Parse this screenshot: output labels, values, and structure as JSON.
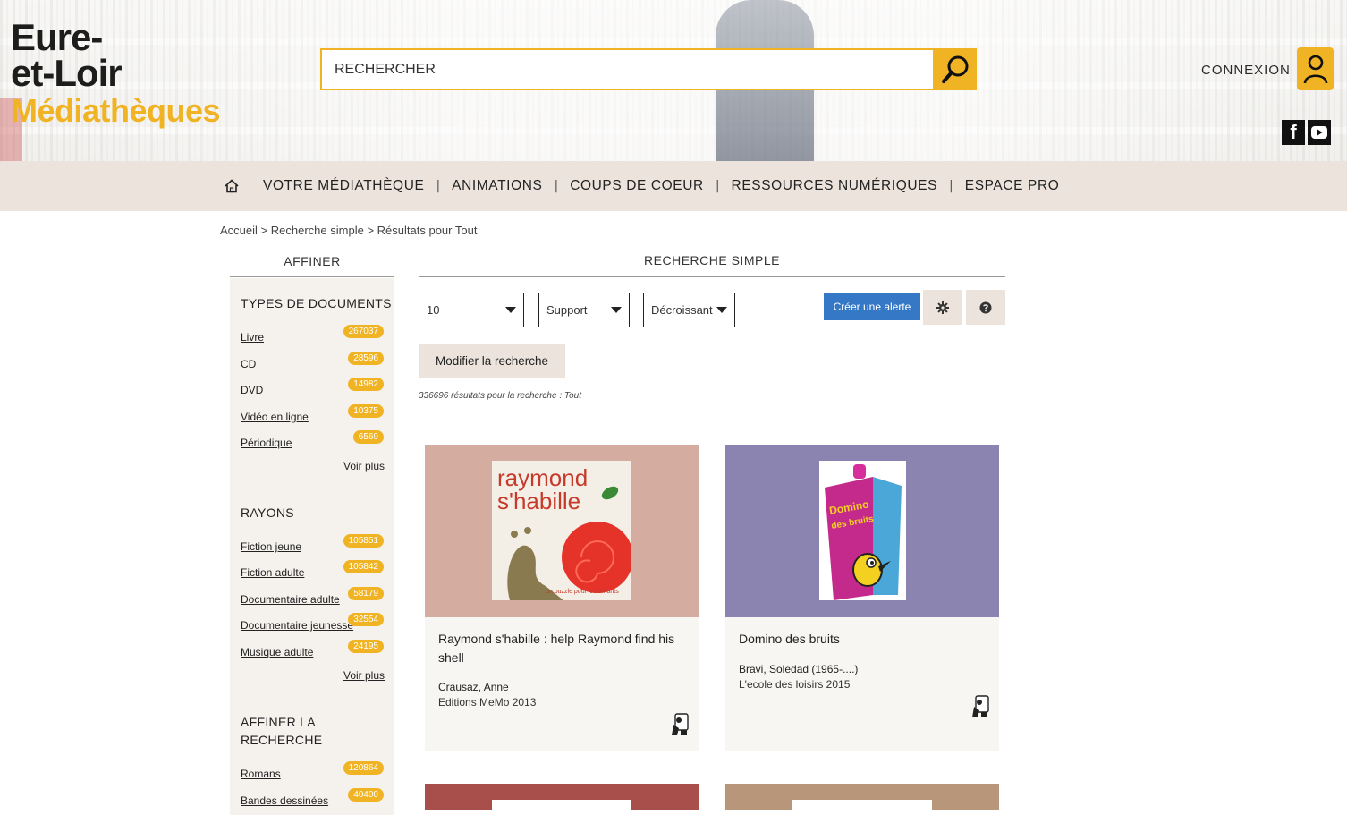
{
  "header": {
    "logo": {
      "line1": "Eure-",
      "line2": "et-Loir",
      "line3": "Médiathèques"
    },
    "search": {
      "placeholder": "RECHERCHER",
      "button_icon": "search-icon"
    },
    "connexion_label": "CONNEXION",
    "user_icon": "user-icon",
    "social": {
      "facebook": "f"
    }
  },
  "nav": {
    "home_icon": "home-icon",
    "items": [
      {
        "label": "VOTRE MÉDIATHÈQUE"
      },
      {
        "label": "ANIMATIONS"
      },
      {
        "label": "COUPS DE COEUR"
      },
      {
        "label": "RESSOURCES NUMÉRIQUES"
      },
      {
        "label": "ESPACE PRO"
      }
    ],
    "separator": "|"
  },
  "breadcrumb": {
    "home": "Accueil",
    "sep": ">",
    "search": "Recherche simple",
    "results": "Résultats pour Tout"
  },
  "sidebar": {
    "title": "AFFINER",
    "facets": [
      {
        "title": "TYPES DE DOCUMENTS",
        "items": [
          {
            "label": "Livre",
            "count": "267037"
          },
          {
            "label": "CD",
            "count": "28596"
          },
          {
            "label": "DVD",
            "count": "14982"
          },
          {
            "label": "Vidéo en ligne",
            "count": "10375"
          },
          {
            "label": "Périodique",
            "count": "6569"
          }
        ],
        "more": "Voir plus"
      },
      {
        "title": "RAYONS",
        "items": [
          {
            "label": "Fiction jeune",
            "count": "105851"
          },
          {
            "label": "Fiction adulte",
            "count": "105842"
          },
          {
            "label": "Documentaire adulte",
            "count": "58179"
          },
          {
            "label": "Documentaire jeunesse",
            "count": "32554"
          },
          {
            "label": "Musique adulte",
            "count": "24195"
          }
        ],
        "more": "Voir plus"
      },
      {
        "title_line1": "AFFINER LA",
        "title_line2": "RECHERCHE",
        "items": [
          {
            "label": "Romans",
            "count": "120864"
          },
          {
            "label": "Bandes dessinées",
            "count": "40400"
          }
        ]
      }
    ]
  },
  "main": {
    "title": "RECHERCHE SIMPLE",
    "selects": {
      "per_page": "10",
      "support": "Support",
      "order": "Décroissant"
    },
    "alert_button": "Créer une alerte",
    "gear_icon": "gear-icon",
    "help_icon": "help-icon",
    "modify_button": "Modifier la recherche",
    "results_count": "336696 résultats pour la recherche : Tout",
    "cards": [
      {
        "cover_text1": "raymond",
        "cover_text2": "s'habille",
        "cover_small": "un puzzle pour les enfants",
        "title": "Raymond s'habille : help Raymond find his shell",
        "author": "Crausaz, Anne",
        "publisher": "Editions MeMo 2013",
        "type_icon": "game-icon",
        "bg_color": "#d4ada0"
      },
      {
        "cover_text1": "Domino",
        "cover_text2": "des bruits",
        "title": "Domino des bruits",
        "author": "Bravi, Soledad (1965-....)",
        "publisher": "L'ecole des loisirs 2015",
        "type_icon": "game-icon",
        "bg_color": "#8c84b0"
      }
    ],
    "partial_cards": [
      {
        "bg_color": "#a84e4b"
      },
      {
        "bg_color": "#b8967a"
      }
    ]
  }
}
